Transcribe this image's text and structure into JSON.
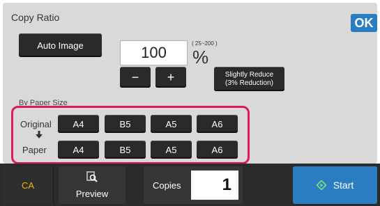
{
  "header": {
    "title": "Copy Ratio",
    "ok_label": "OK"
  },
  "ratio": {
    "auto_image_label": "Auto Image",
    "value": "100",
    "range": "( 25~200 )",
    "unit": "%",
    "minus_label": "−",
    "plus_label": "+",
    "slightly_reduce_line1": "Slightly Reduce",
    "slightly_reduce_line2": "(3% Reduction)"
  },
  "by_paper_size": {
    "section_label": "By Paper Size",
    "original_label": "Original",
    "paper_label": "Paper",
    "original_sizes": [
      "A4",
      "B5",
      "A5",
      "A6"
    ],
    "paper_sizes": [
      "A4",
      "B5",
      "A5",
      "A6"
    ],
    "highlight_color": "#e0195a"
  },
  "footer": {
    "ca_label": "CA",
    "preview_label": "Preview",
    "copies_label": "Copies",
    "copies_value": "1",
    "start_label": "Start"
  },
  "icons": {
    "arrow": "arrow-down-icon",
    "preview": "preview-icon",
    "start": "start-icon"
  },
  "colors": {
    "accent": "#2a7dc0",
    "ca_text": "#f0b400"
  }
}
